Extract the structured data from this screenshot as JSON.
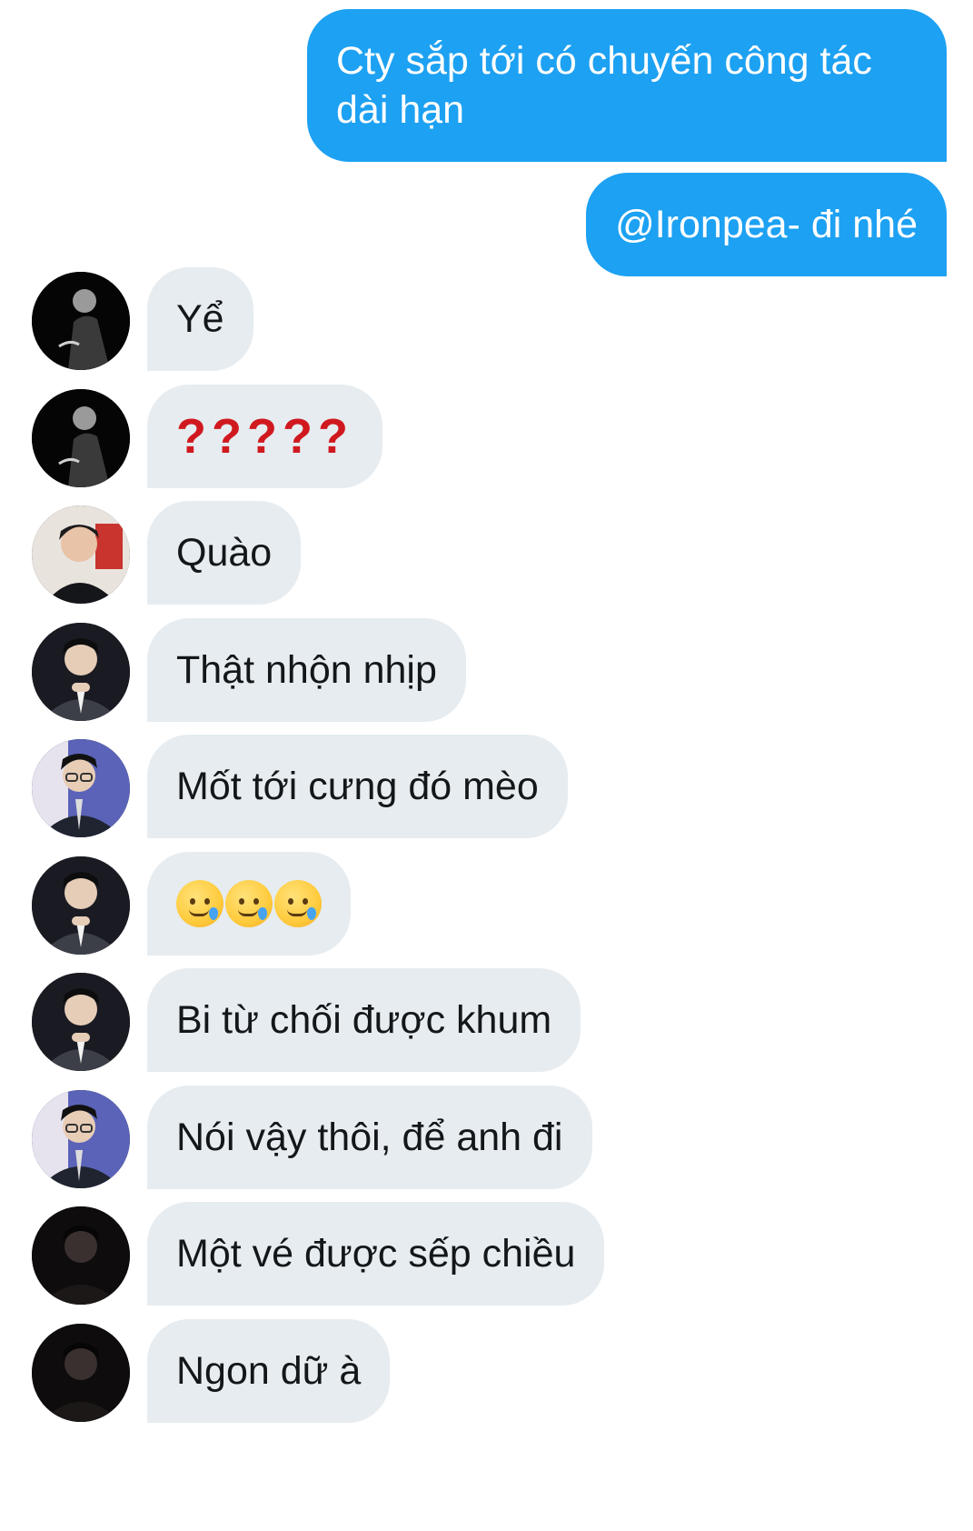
{
  "outgoing": [
    {
      "text": "Cty sắp tới có chuyến công tác dài hạn"
    },
    {
      "text": "@Ironpea- đi nhé"
    }
  ],
  "incoming": [
    {
      "avatar": "avatar-dark-profile",
      "text": "Yể"
    },
    {
      "avatar": "avatar-dark-profile",
      "text": "?????"
    },
    {
      "avatar": "avatar-light-portrait",
      "text": "Quào"
    },
    {
      "avatar": "avatar-suit-portrait",
      "text": "Thật nhộn nhịp"
    },
    {
      "avatar": "avatar-glasses-portrait",
      "text": "Mốt tới cưng đó mèo"
    },
    {
      "avatar": "avatar-suit-portrait",
      "emoji": [
        "smiling-face-with-tear",
        "smiling-face-with-tear",
        "smiling-face-with-tear"
      ]
    },
    {
      "avatar": "avatar-suit-portrait",
      "text": "Bi từ chối được khum"
    },
    {
      "avatar": "avatar-glasses-portrait",
      "text": "Nói vậy thôi, để anh đi"
    },
    {
      "avatar": "avatar-shadow-portrait",
      "text": "Một vé được sếp chiều"
    },
    {
      "avatar": "avatar-shadow-portrait",
      "text": "Ngon dữ à"
    }
  ],
  "colors": {
    "outgoing_bubble": "#1da1f2",
    "incoming_bubble": "#e6ecf0",
    "question_marks": "#d0191f"
  }
}
